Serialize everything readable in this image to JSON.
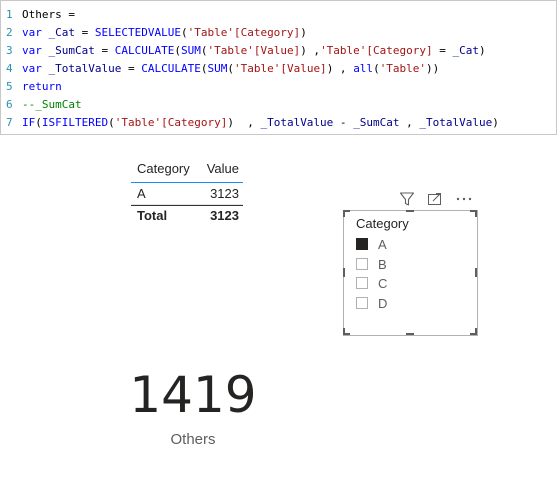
{
  "editor": {
    "lines": [
      {
        "num": "1",
        "text": "Others ="
      },
      {
        "num": "2",
        "parts": [
          "var ",
          "_Cat",
          " = ",
          "SELECTEDVALUE",
          "(",
          "'Table'[Category]",
          ")"
        ]
      },
      {
        "num": "3",
        "parts": [
          "var ",
          "_SumCat",
          " = ",
          "CALCULATE",
          "(",
          "SUM",
          "(",
          "'Table'[Value]",
          ") ,",
          "'Table'[Category]",
          " = ",
          "_Cat",
          ")"
        ]
      },
      {
        "num": "4",
        "parts": [
          "var ",
          "_TotalValue",
          " = ",
          "CALCULATE",
          "(",
          "SUM",
          "(",
          "'Table'[Value]",
          ") , ",
          "all",
          "(",
          "'Table'",
          "))"
        ]
      },
      {
        "num": "5",
        "text": "return"
      },
      {
        "num": "6",
        "text": "--_SumCat"
      },
      {
        "num": "7",
        "parts": [
          "IF",
          "(",
          "ISFILTERED",
          "(",
          "'Table'[Category]",
          ")  , ",
          "_TotalValue",
          " - ",
          "_SumCat",
          " , ",
          "_TotalValue",
          ")"
        ]
      }
    ]
  },
  "table": {
    "headers": [
      "Category",
      "Value"
    ],
    "rows": [
      [
        "A",
        "3123"
      ]
    ],
    "total": [
      "Total",
      "3123"
    ]
  },
  "slicer": {
    "title": "Category",
    "items": [
      {
        "label": "A",
        "checked": true
      },
      {
        "label": "B",
        "checked": false
      },
      {
        "label": "C",
        "checked": false
      },
      {
        "label": "D",
        "checked": false
      }
    ],
    "icons": [
      "filter-icon",
      "focus-mode-icon",
      "more-options-icon"
    ]
  },
  "card": {
    "value": "1419",
    "label": "Others"
  },
  "colors": {
    "accent": "#118dff",
    "keyword": "#0000ff",
    "comment": "#008000",
    "string": "#a31515",
    "line_number": "#2b91af"
  }
}
